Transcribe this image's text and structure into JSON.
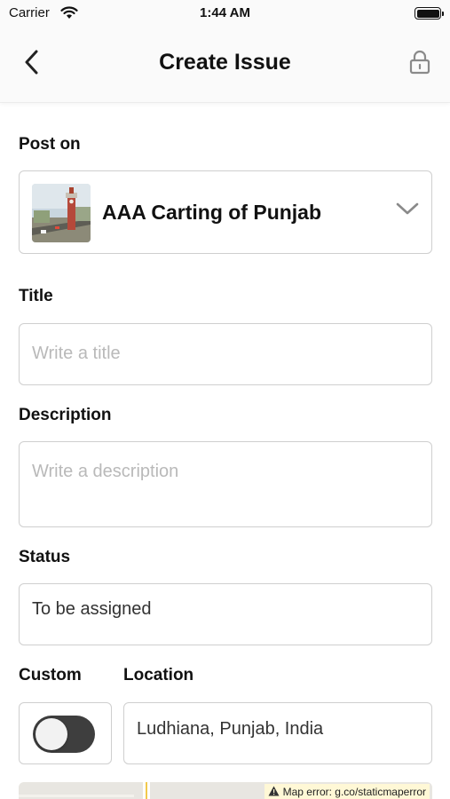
{
  "status_bar": {
    "carrier": "Carrier",
    "time": "1:44 AM",
    "icons": [
      "wifi-icon",
      "battery-icon"
    ]
  },
  "nav": {
    "title": "Create Issue",
    "back_icon": "chevron-left-icon",
    "lock_icon": "lock-icon"
  },
  "form": {
    "post_on": {
      "label": "Post on",
      "value": "AAA Carting of Punjab",
      "thumbnail_icon": "clock-tower-photo",
      "dropdown_icon": "chevron-down-icon"
    },
    "title": {
      "label": "Title",
      "placeholder": "Write a title",
      "value": ""
    },
    "description": {
      "label": "Description",
      "placeholder": "Write a description",
      "value": ""
    },
    "status": {
      "label": "Status",
      "value": "To be assigned"
    },
    "custom": {
      "label": "Custom",
      "toggle_on": false
    },
    "location": {
      "label": "Location",
      "value": "Ludhiana, Punjab, India"
    },
    "map": {
      "error_text": "Map error: g.co/staticmaperror",
      "error_icon": "warning-icon"
    }
  },
  "colors": {
    "toggle_track": "#3e3e3e",
    "border": "#cfcfcf",
    "placeholder": "#b9b9b9",
    "map_error_bg": "#fff8d6"
  }
}
